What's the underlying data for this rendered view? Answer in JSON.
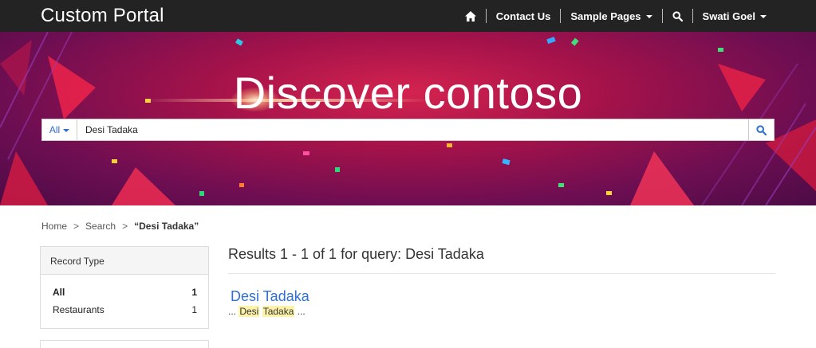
{
  "brand": "Custom Portal",
  "nav": {
    "contact": "Contact Us",
    "sample_pages": "Sample Pages",
    "user": "Swati Goel"
  },
  "hero": {
    "title": "Discover contoso"
  },
  "search": {
    "filter_label": "All",
    "query": "Desi Tadaka"
  },
  "breadcrumb": {
    "home": "Home",
    "sep": ">",
    "search": "Search",
    "current": "“Desi Tadaka”"
  },
  "facet": {
    "title": "Record Type",
    "items": [
      {
        "label": "All",
        "count": "1"
      },
      {
        "label": "Restaurants",
        "count": "1"
      }
    ]
  },
  "results": {
    "summary": "Results 1 - 1 of 1 for query: Desi Tadaka",
    "items": [
      {
        "title": "Desi Tadaka",
        "snippet_prefix": "... ",
        "hl1": "Desi",
        "hl2": "Tadaka",
        "snippet_suffix": " ..."
      }
    ]
  },
  "colors": {
    "nav_bg": "#232323",
    "accent": "#2f6fd1",
    "hero_base": "#a4124a",
    "highlight": "#fdf3a8"
  },
  "icons": [
    "home-icon",
    "search-icon",
    "chevron-down-icon"
  ]
}
